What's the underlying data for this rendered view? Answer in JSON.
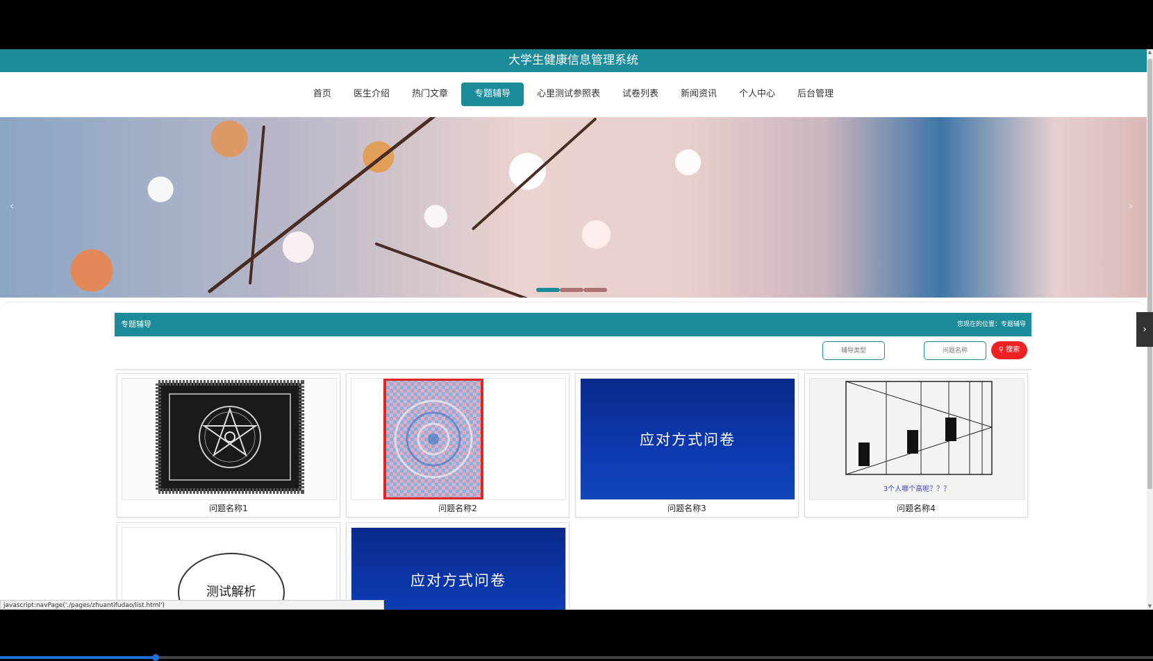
{
  "header": {
    "title": "大学生健康信息管理系统"
  },
  "nav": {
    "items": [
      {
        "label": "首页",
        "active": false
      },
      {
        "label": "医生介绍",
        "active": false
      },
      {
        "label": "热门文章",
        "active": false
      },
      {
        "label": "专题辅导",
        "active": true
      },
      {
        "label": "心里测试参照表",
        "active": false
      },
      {
        "label": "试卷列表",
        "active": false
      },
      {
        "label": "新闻资讯",
        "active": false
      },
      {
        "label": "个人中心",
        "active": false
      },
      {
        "label": "后台管理",
        "active": false
      }
    ]
  },
  "banner": {
    "slides": 3,
    "active_slide": 1
  },
  "section": {
    "title": "专题辅导",
    "breadcrumb": "您现在的位置：专题辅导"
  },
  "filters": {
    "type_placeholder": "辅导类型",
    "name_placeholder": "问题名称",
    "search_label": "搜索"
  },
  "cards": [
    {
      "caption": "问题名称1",
      "image": "pentagram-pattern"
    },
    {
      "caption": "问题名称2",
      "image": "optical-illusion-spiral"
    },
    {
      "caption": "问题名称3",
      "image": "slide",
      "slide_text": "应对方式问卷"
    },
    {
      "caption": "问题名称4",
      "image": "corridor-illusion",
      "image_text": "3个人哪个高呢？？？"
    },
    {
      "caption": "",
      "image": "circle-label",
      "image_text": "测试解析"
    },
    {
      "caption": "",
      "image": "slide",
      "slide_text": "应对方式问卷"
    }
  ],
  "status_bar": {
    "url": "javascript:navPage('./pages/zhuantifudao/list.html')"
  },
  "colors": {
    "primary": "#1b8a99",
    "search": "#ee2222"
  },
  "video_progress": {
    "fraction": 0.135
  }
}
